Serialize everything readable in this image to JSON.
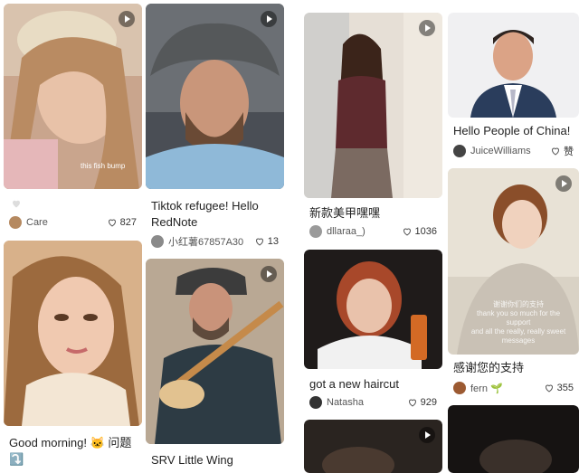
{
  "feed": {
    "cards": [
      {
        "id": "c1",
        "title": "",
        "author": "Care",
        "likes": "827",
        "video": true
      },
      {
        "id": "c2",
        "title": "Tiktok refugee! Hello RedNote",
        "author": "小红薯67857A30",
        "likes": "13",
        "video": true
      },
      {
        "id": "c3",
        "title": "Good morning! 🐱 问题 ⤵️",
        "author": "",
        "likes": "",
        "video": false
      },
      {
        "id": "c4",
        "title": "SRV Little Wing",
        "author": "",
        "likes": "",
        "video": true
      },
      {
        "id": "c5",
        "title": "新款美甲嘿嘿",
        "author": "dllaraa_)",
        "likes": "1036",
        "video": true
      },
      {
        "id": "c6",
        "title": "Hello People of China!",
        "author": "JuiceWilliams",
        "likes": "赞",
        "video": false
      },
      {
        "id": "c7",
        "title": "got a new haircut",
        "author": "Natasha",
        "likes": "929",
        "video": false
      },
      {
        "id": "c8",
        "title": "感谢您的支持",
        "author": "fern 🌱",
        "likes": "355",
        "video": true,
        "caption_line1": "谢谢你们的支持",
        "caption_line2": "thank you so much for the support",
        "caption_line3": "and all the really, really sweet messages"
      },
      {
        "id": "c9",
        "title": "",
        "author": "",
        "likes": "",
        "video": true
      },
      {
        "id": "c10",
        "title": "",
        "author": "",
        "likes": "",
        "video": false
      }
    ],
    "image_caption_c1": "this fish bump"
  },
  "colors": {
    "heart_outline": "#555555",
    "background": "#ffffff",
    "text": "#222222"
  }
}
